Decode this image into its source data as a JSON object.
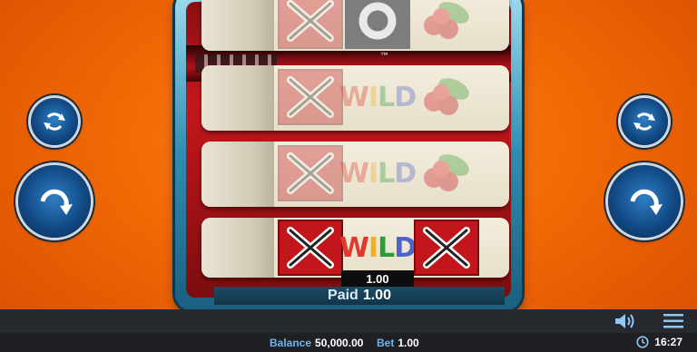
{
  "game": {
    "logo_mark": "™",
    "tickets": [
      {
        "row": 1,
        "symbols": [
          "X",
          "O",
          "cherries"
        ],
        "winning": false
      },
      {
        "row": 2,
        "symbols": [
          "X",
          "WILD",
          "cherries"
        ],
        "winning": false
      },
      {
        "row": 3,
        "symbols": [
          "X",
          "WILD",
          "cherries"
        ],
        "winning": false
      },
      {
        "row": 4,
        "symbols": [
          "X",
          "WILD",
          "X"
        ],
        "winning": true
      }
    ],
    "wild_label": "WILD",
    "win_amount": "1.00",
    "paid_label": "Paid",
    "paid_value": "1.00"
  },
  "controls": {
    "left_autoplay_icon": "autoplay-icon",
    "left_spin_icon": "spin-icon",
    "right_autoplay_icon": "autoplay-icon",
    "right_spin_icon": "spin-icon"
  },
  "footer": {
    "balance_label": "Balance",
    "balance_value": "50,000.00",
    "bet_label": "Bet",
    "bet_value": "1.00",
    "time": "16:27",
    "sound_icon": "speaker-icon",
    "menu_icon": "hamburger-menu-icon",
    "clock_icon": "clock-icon"
  },
  "colors": {
    "background": "#f26a05",
    "symbol_red": "#c3151c",
    "accent_blue": "#6fb4ee"
  }
}
